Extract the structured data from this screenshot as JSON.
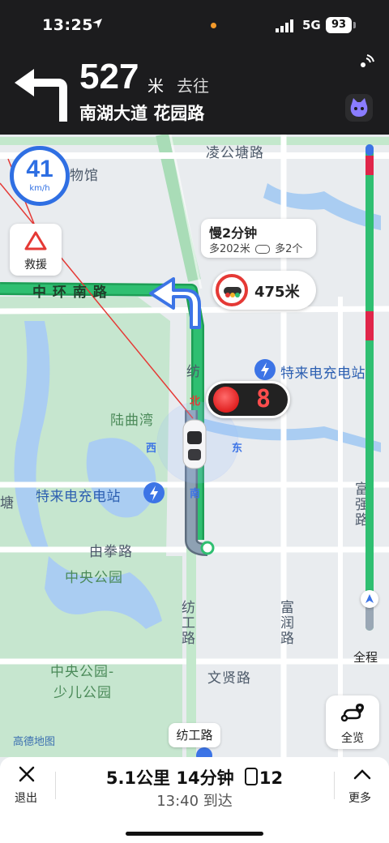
{
  "status_bar": {
    "time": "13:25",
    "network": "5G",
    "battery": "93"
  },
  "nav": {
    "distance": "527",
    "unit": "米",
    "goto_word": "去往",
    "road": "南湖大道 花园路",
    "turn_direction": "turn-left-icon"
  },
  "speed": {
    "value": "41",
    "unit": "km/h"
  },
  "sos": {
    "label": "救援"
  },
  "traffic_bubble": {
    "title": "慢2分钟",
    "sub_left": "多202米",
    "sub_right": "多2个"
  },
  "light_bubble": {
    "distance": "475米"
  },
  "countdown": {
    "value": "8"
  },
  "map_labels": {
    "lingong": "凌公塘路",
    "museum": "物馆",
    "zhonghuan": "中 环 南 路",
    "luquwan": "陆曲湾",
    "charger1": "特来电充电站",
    "charger2": "特来电充电站",
    "youquan": "由拳路",
    "central_park": "中央公园",
    "central_park_kids1": "中央公园-",
    "central_park_kids2": "少儿公园",
    "wenxian": "文贤路",
    "fanggong_v": "纺工路",
    "furun": "富润路",
    "fuqiang": "富强路",
    "fang_top": "纺",
    "tang": "塘",
    "north": "北",
    "south": "南",
    "west": "西",
    "east": "东"
  },
  "rail": {
    "overview_label": "全程"
  },
  "fullview": {
    "label": "全览"
  },
  "road_tag": "纺工路",
  "brand": "高德地图",
  "bottom": {
    "exit_label": "退出",
    "trip_distance": "5.1公里",
    "trip_time": "14分钟",
    "lights": "12",
    "eta": "13:40 到达",
    "more_label": "更多"
  },
  "colors": {
    "route_green": "#2fbf71",
    "route_red": "#e0264a",
    "accent_blue": "#2f6fe3",
    "header_bg": "#1c1c1e"
  }
}
